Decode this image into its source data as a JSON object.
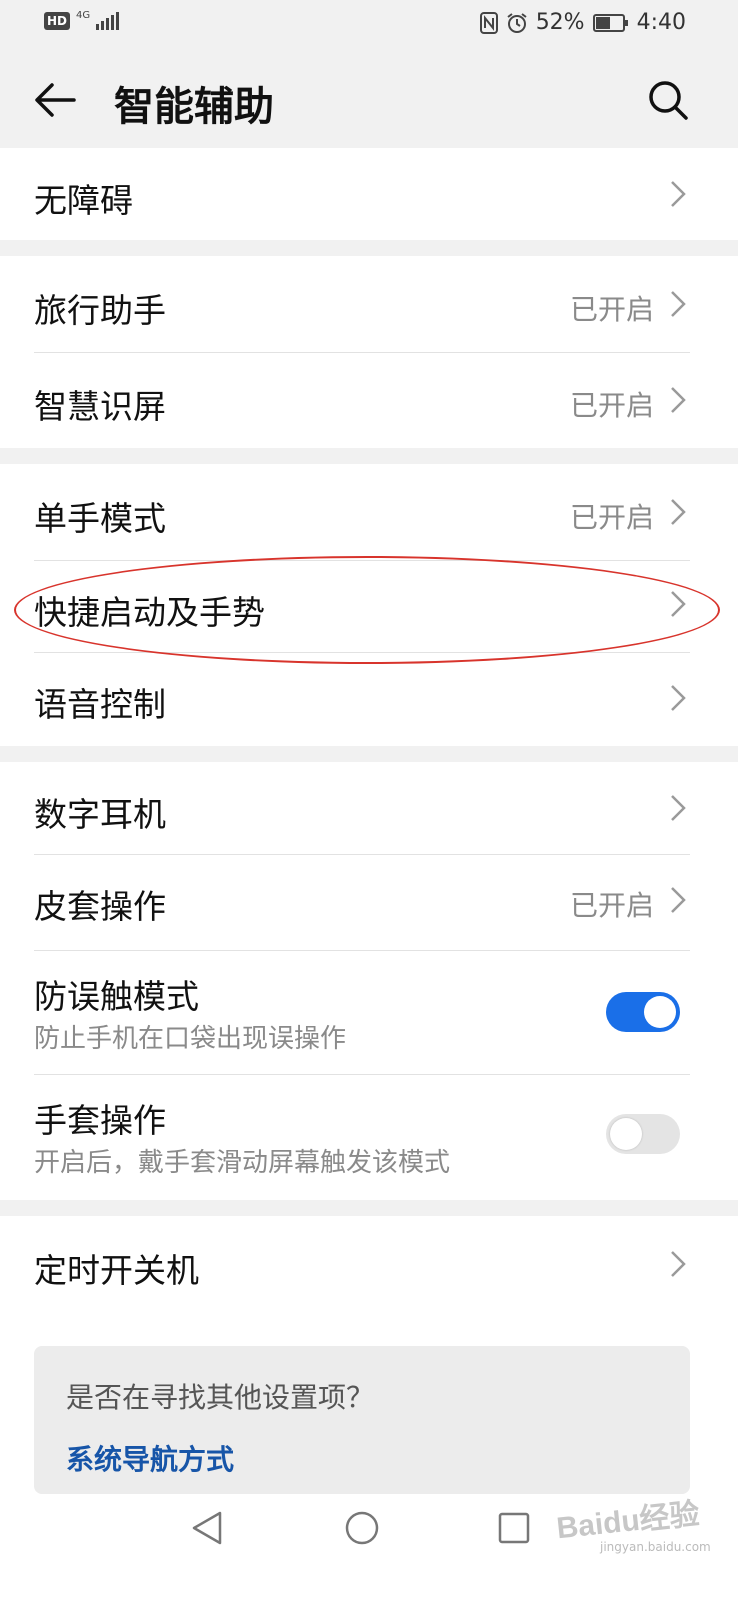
{
  "status_bar": {
    "hd": "HD",
    "network": "4G",
    "battery_percent": "52%",
    "time": "4:40",
    "icons": [
      "nfc-icon",
      "alarm-icon",
      "battery-icon"
    ]
  },
  "header": {
    "title": "智能辅助",
    "back_icon": "arrow-left",
    "search_icon": "magnifier"
  },
  "groups": [
    {
      "items": [
        {
          "label": "无障碍",
          "status": ""
        }
      ]
    },
    {
      "items": [
        {
          "label": "旅行助手",
          "status": "已开启"
        },
        {
          "label": "智慧识屏",
          "status": "已开启"
        }
      ]
    },
    {
      "items": [
        {
          "label": "单手模式",
          "status": "已开启"
        },
        {
          "label": "快捷启动及手势",
          "status": ""
        },
        {
          "label": "语音控制",
          "status": ""
        }
      ]
    },
    {
      "items": [
        {
          "label": "数字耳机",
          "status": ""
        },
        {
          "label": "皮套操作",
          "status": "已开启"
        },
        {
          "label": "防误触模式",
          "subtitle": "防止手机在口袋出现误操作",
          "toggle": true
        },
        {
          "label": "手套操作",
          "subtitle": "开启后，戴手套滑动屏幕触发该模式",
          "toggle": false
        }
      ]
    },
    {
      "items": [
        {
          "label": "定时开关机",
          "status": ""
        }
      ]
    }
  ],
  "suggestion": {
    "question": "是否在寻找其他设置项？",
    "link": "系统导航方式"
  },
  "watermark": {
    "brand": "Baidu经验",
    "site": "jingyan.baidu.com"
  },
  "colors": {
    "accent": "#1a6fe8",
    "link": "#1755a8",
    "annotation": "#d8342c",
    "status_text": "#8a8a8a"
  }
}
